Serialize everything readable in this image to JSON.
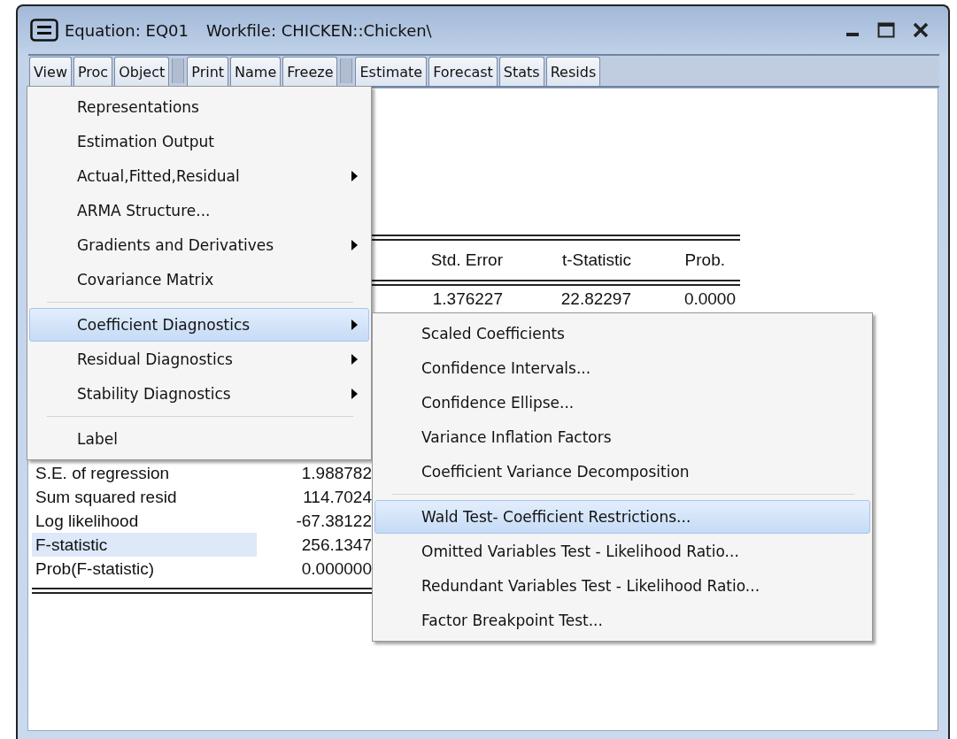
{
  "window": {
    "title": "Equation: EQ01",
    "workfile": "Workfile: CHICKEN::Chicken\\"
  },
  "toolbar": {
    "groups": [
      [
        "View",
        "Proc",
        "Object"
      ],
      [
        "Print",
        "Name",
        "Freeze"
      ],
      [
        "Estimate",
        "Forecast",
        "Stats",
        "Resids"
      ]
    ]
  },
  "output": {
    "header": [
      "Std. Error",
      "t-Statistic",
      "Prob."
    ],
    "row": [
      "1.376227",
      "22.82297",
      "0.0000"
    ],
    "stats": [
      {
        "label": "S.E. of regression",
        "value": "1.988782",
        "selected": false
      },
      {
        "label": "Sum squared resid",
        "value": "114.7024",
        "selected": false
      },
      {
        "label": "Log likelihood",
        "value": "-67.38122",
        "selected": false
      },
      {
        "label": "F-statistic",
        "value": "256.1347",
        "selected": true
      },
      {
        "label": "Prob(F-statistic)",
        "value": "0.000000",
        "selected": false
      }
    ]
  },
  "view_menu": {
    "items": [
      {
        "kind": "item",
        "label": "Representations",
        "has_submenu": false,
        "selected": false
      },
      {
        "kind": "item",
        "label": "Estimation Output",
        "has_submenu": false,
        "selected": false
      },
      {
        "kind": "item",
        "label": "Actual,Fitted,Residual",
        "has_submenu": true,
        "selected": false
      },
      {
        "kind": "item",
        "label": "ARMA Structure...",
        "has_submenu": false,
        "selected": false
      },
      {
        "kind": "item",
        "label": "Gradients and Derivatives",
        "has_submenu": true,
        "selected": false
      },
      {
        "kind": "item",
        "label": "Covariance Matrix",
        "has_submenu": false,
        "selected": false
      },
      {
        "kind": "separator"
      },
      {
        "kind": "item",
        "label": "Coefficient Diagnostics",
        "has_submenu": true,
        "selected": true
      },
      {
        "kind": "item",
        "label": "Residual Diagnostics",
        "has_submenu": true,
        "selected": false
      },
      {
        "kind": "item",
        "label": "Stability Diagnostics",
        "has_submenu": true,
        "selected": false
      },
      {
        "kind": "separator"
      },
      {
        "kind": "item",
        "label": "Label",
        "has_submenu": false,
        "selected": false
      }
    ]
  },
  "submenu": {
    "items": [
      {
        "kind": "item",
        "label": "Scaled Coefficients",
        "selected": false
      },
      {
        "kind": "item",
        "label": "Confidence Intervals...",
        "selected": false
      },
      {
        "kind": "item",
        "label": "Confidence Ellipse...",
        "selected": false
      },
      {
        "kind": "item",
        "label": "Variance Inflation Factors",
        "selected": false
      },
      {
        "kind": "item",
        "label": "Coefficient Variance Decomposition",
        "selected": false
      },
      {
        "kind": "separator"
      },
      {
        "kind": "item",
        "label": "Wald Test- Coefficient Restrictions...",
        "selected": true
      },
      {
        "kind": "item",
        "label": "Omitted Variables Test - Likelihood Ratio...",
        "selected": false
      },
      {
        "kind": "item",
        "label": "Redundant Variables Test - Likelihood Ratio...",
        "selected": false
      },
      {
        "kind": "item",
        "label": "Factor Breakpoint Test...",
        "selected": false
      }
    ]
  }
}
